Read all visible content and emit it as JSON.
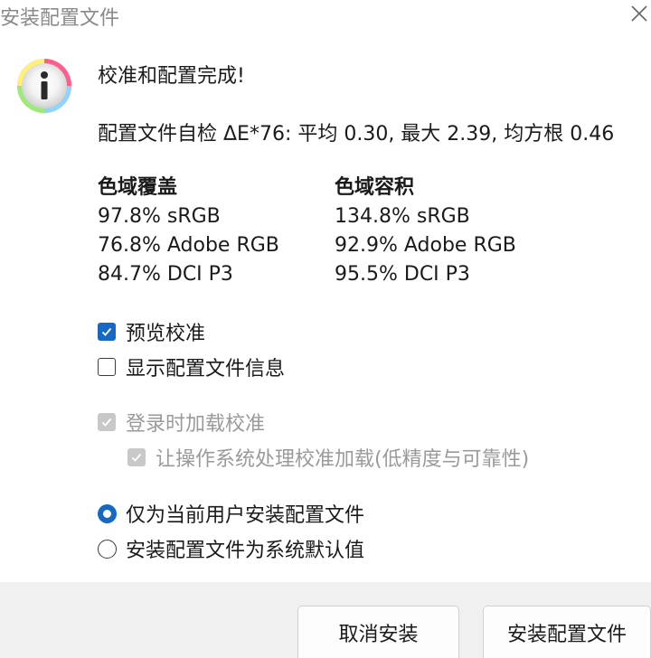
{
  "window": {
    "title": "安装配置文件"
  },
  "message": {
    "heading": "校准和配置完成!",
    "self_check": "配置文件自检 ΔE*76: 平均 0.30, 最大 2.39, 均方根 0.46"
  },
  "gamut": {
    "coverage": {
      "header": "色域覆盖",
      "items": [
        "97.8% sRGB",
        "76.8% Adobe RGB",
        "84.7% DCI P3"
      ]
    },
    "volume": {
      "header": "色域容积",
      "items": [
        "134.8% sRGB",
        "92.9% Adobe RGB",
        "95.5% DCI P3"
      ]
    }
  },
  "options": {
    "preview_calibration": {
      "label": "预览校准",
      "checked": true
    },
    "show_profile_info": {
      "label": "显示配置文件信息",
      "checked": false
    },
    "load_on_login": {
      "label": "登录时加载校准",
      "checked": true,
      "disabled": true
    },
    "os_handle_loading": {
      "label": "让操作系统处理校准加载(低精度与可靠性)",
      "checked": true,
      "disabled": true
    }
  },
  "install_scope": {
    "current_user": {
      "label": "仅为当前用户安装配置文件",
      "selected": true
    },
    "system_default": {
      "label": "安装配置文件为系统默认值",
      "selected": false
    }
  },
  "buttons": {
    "cancel": "取消安装",
    "install": "安装配置文件"
  },
  "colors": {
    "accent": "#1668c4",
    "disabled": "#c8c8c8",
    "footer_bg": "#f0f0f0"
  }
}
